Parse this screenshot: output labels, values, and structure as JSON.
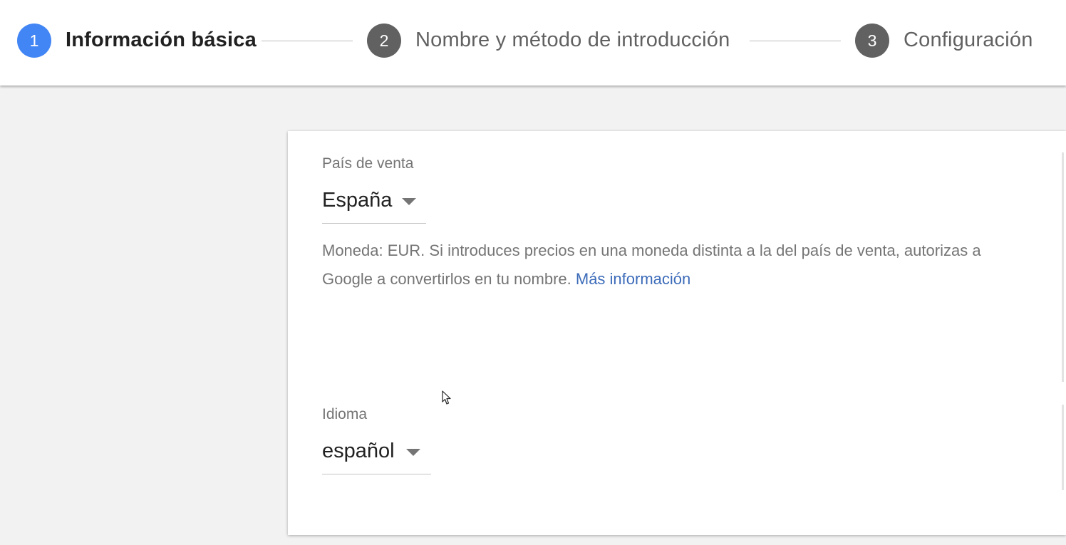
{
  "stepper": {
    "steps": [
      {
        "number": "1",
        "label": "Información básica",
        "state": "active"
      },
      {
        "number": "2",
        "label": "Nombre y método de introducción",
        "state": "pending"
      },
      {
        "number": "3",
        "label": "Configuración",
        "state": "pending"
      }
    ]
  },
  "form": {
    "country": {
      "label": "País de venta",
      "value": "España"
    },
    "currency_note": {
      "text": "Moneda: EUR. Si introduces precios en una moneda distinta a la del país de venta, autorizas a Google a convertirlos en tu nombre.",
      "link_label": "Más información"
    },
    "language": {
      "label": "Idioma",
      "value": "español"
    }
  },
  "colors": {
    "active_step": "#4285f4",
    "pending_step": "#616161",
    "active_text": "#212121",
    "pending_text": "#616161",
    "link": "#3c6bb9",
    "background": "#f2f2f2"
  }
}
